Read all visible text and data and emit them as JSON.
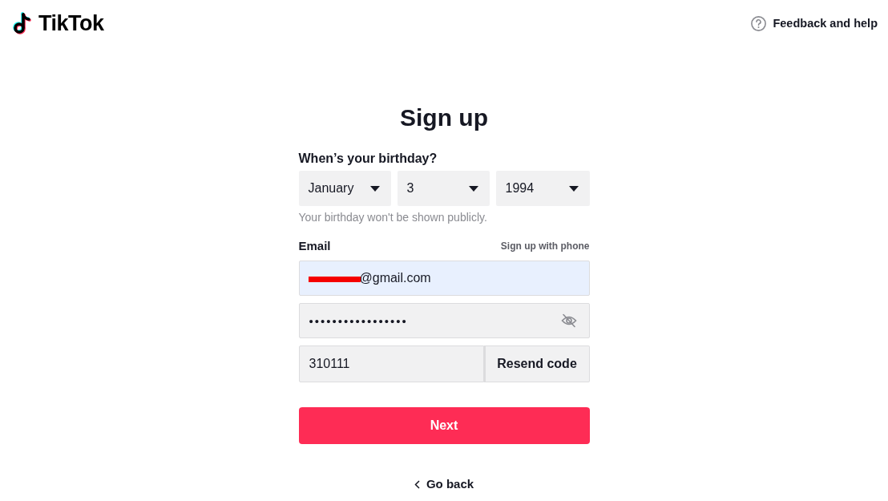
{
  "header": {
    "logo": {
      "text": "TikTok"
    },
    "help_link": {
      "label": "Feedback and help"
    }
  },
  "form": {
    "title": "Sign up",
    "birthday": {
      "label": "When’s your birthday?",
      "selects": [
        {
          "value": "January"
        },
        {
          "value": "3"
        },
        {
          "value": "1994"
        }
      ],
      "hint": "Your birthday won't be shown publicly."
    },
    "email": {
      "label": "Email",
      "switch_link": "Sign up with phone",
      "value": "@gmail.com",
      "redacted": true,
      "autofilled": true
    },
    "password": {
      "value": "•••••••••••••••••",
      "hidden": true
    },
    "code": {
      "value": "310111",
      "resend_button": "Resend code"
    },
    "next_button": "Next",
    "back_link": "Go back"
  }
}
